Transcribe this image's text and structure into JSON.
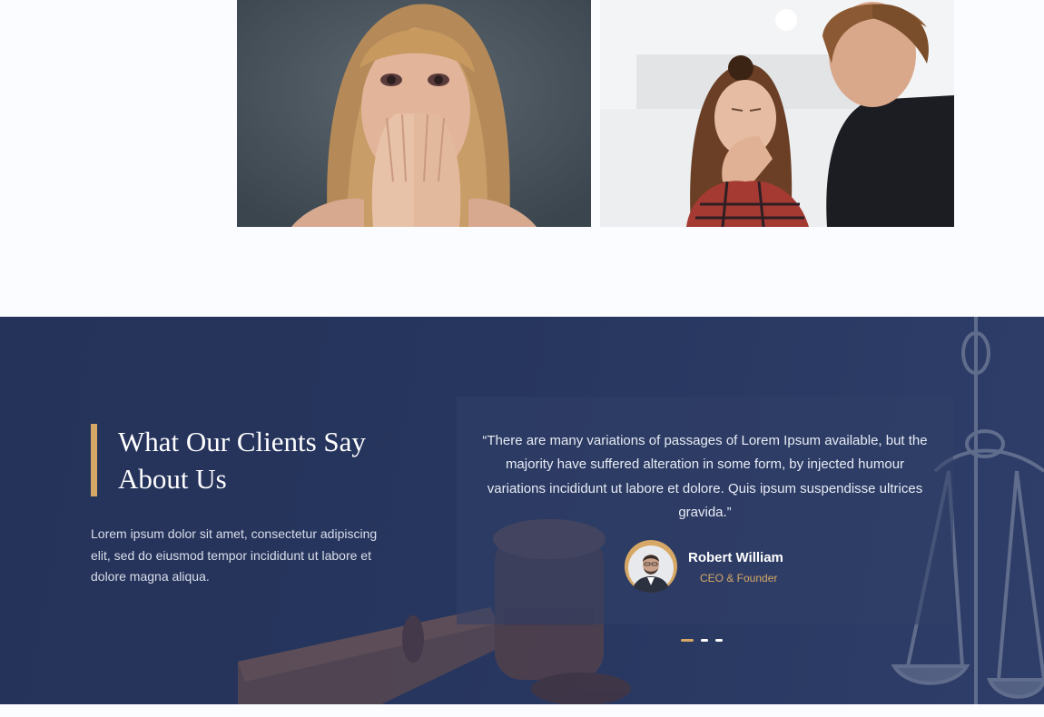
{
  "gallery": {
    "images": [
      {
        "alt": "distressed-woman-covering-mouth"
      },
      {
        "alt": "crying-woman-with-man"
      }
    ]
  },
  "testimonials": {
    "title": "What Our Clients Say About Us",
    "description": "Lorem ipsum dolor sit amet, consectetur adipiscing elit, sed do eiusmod tempor incididunt ut labore et dolore magna aliqua.",
    "quote": "“There are many variations of passages of Lorem Ipsum available, but the majority have suffered alteration in some form, by injected humour variations incididunt ut labore et dolore. Quis ipsum suspendisse ultrices gravida.”",
    "author": {
      "name": "Robert William",
      "role": "CEO & Founder"
    },
    "slider": {
      "count": 3,
      "active_index": 0
    }
  },
  "colors": {
    "accent": "#d7a865",
    "section_background": "#27365e",
    "page_background": "#fbfcff"
  },
  "icons": {
    "background_gavel": "gavel-icon",
    "background_scales": "scales-of-justice-icon"
  }
}
